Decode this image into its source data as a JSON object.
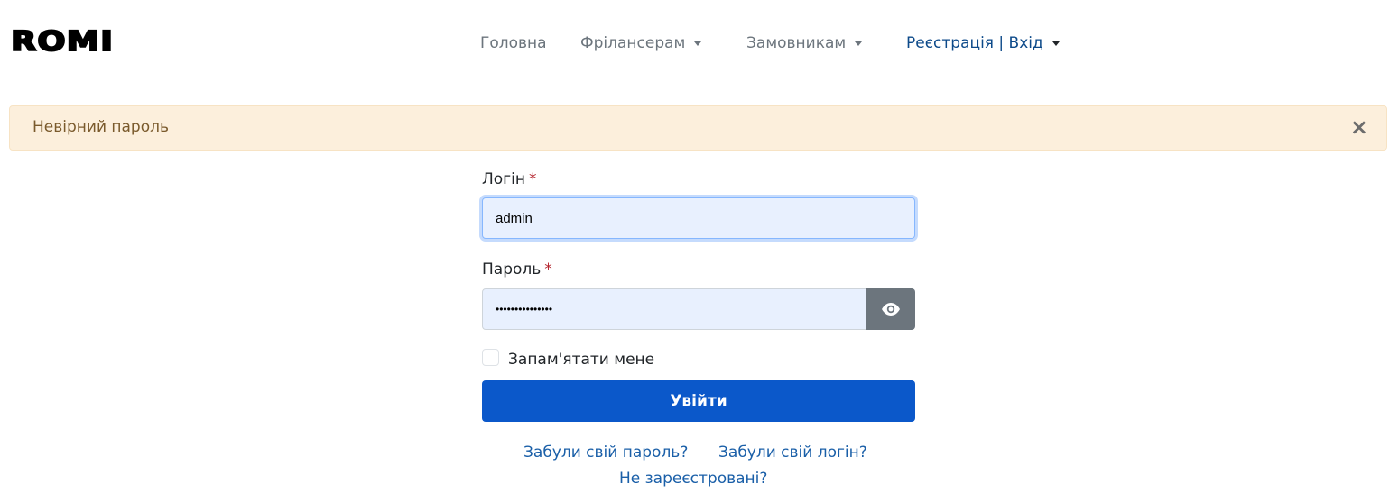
{
  "brand": {
    "logo_text": "ROMI"
  },
  "nav": {
    "home": "Головна",
    "freelancers": "Фрілансерам",
    "customers": "Замовникам",
    "register_login": "Реєстрація | Вхід"
  },
  "alert": {
    "message": "Невірний пароль",
    "close_symbol": "×"
  },
  "form": {
    "login_label": "Логін",
    "login_value": "admin",
    "password_label": "Пароль",
    "password_mask": "•••••••••••••••",
    "required_marker": "*",
    "remember_label": "Запам'ятати мене",
    "submit_label": "Увійти"
  },
  "links": {
    "forgot_password": "Забули свій пароль?",
    "forgot_login": "Забули свій логін?",
    "not_registered": "Не зареєстровані?"
  },
  "colors": {
    "primary": "#0b58ca",
    "alert_bg": "#fcefdc",
    "link": "#1a5fa8"
  }
}
